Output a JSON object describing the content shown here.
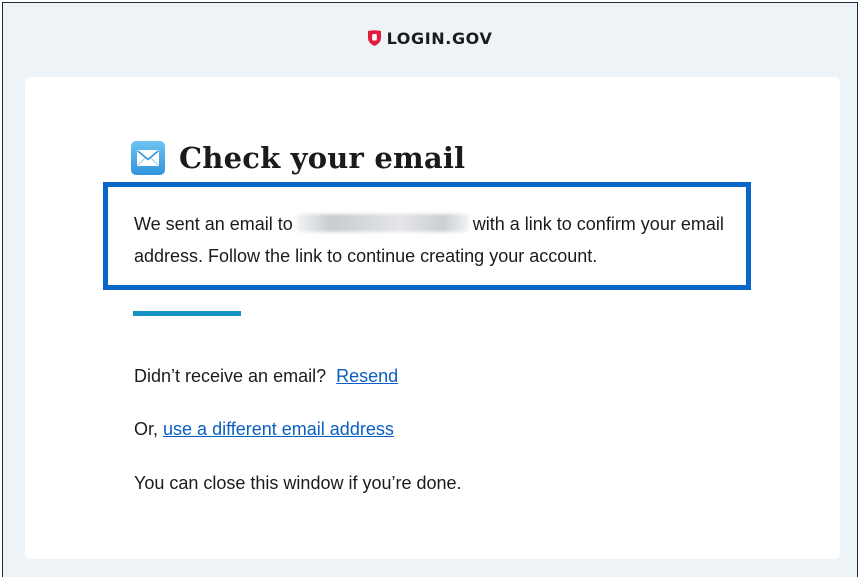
{
  "header": {
    "brand": "LOGIN.GOV"
  },
  "main": {
    "title": "Check your email",
    "message_before": "We sent an email to",
    "message_after": "with a link to confirm your email address. Follow the link to continue creating your account.",
    "resend_prompt": "Didn’t receive an email?",
    "resend_link": "Resend",
    "alt_prefix": "Or,",
    "alt_link": "use a different email address",
    "close_text": "You can close this window if you’re done."
  },
  "colors": {
    "highlight_border": "#0a67c9",
    "divider": "#1591c6",
    "link": "#0b5fc1",
    "brand_red": "#e21c3d"
  }
}
